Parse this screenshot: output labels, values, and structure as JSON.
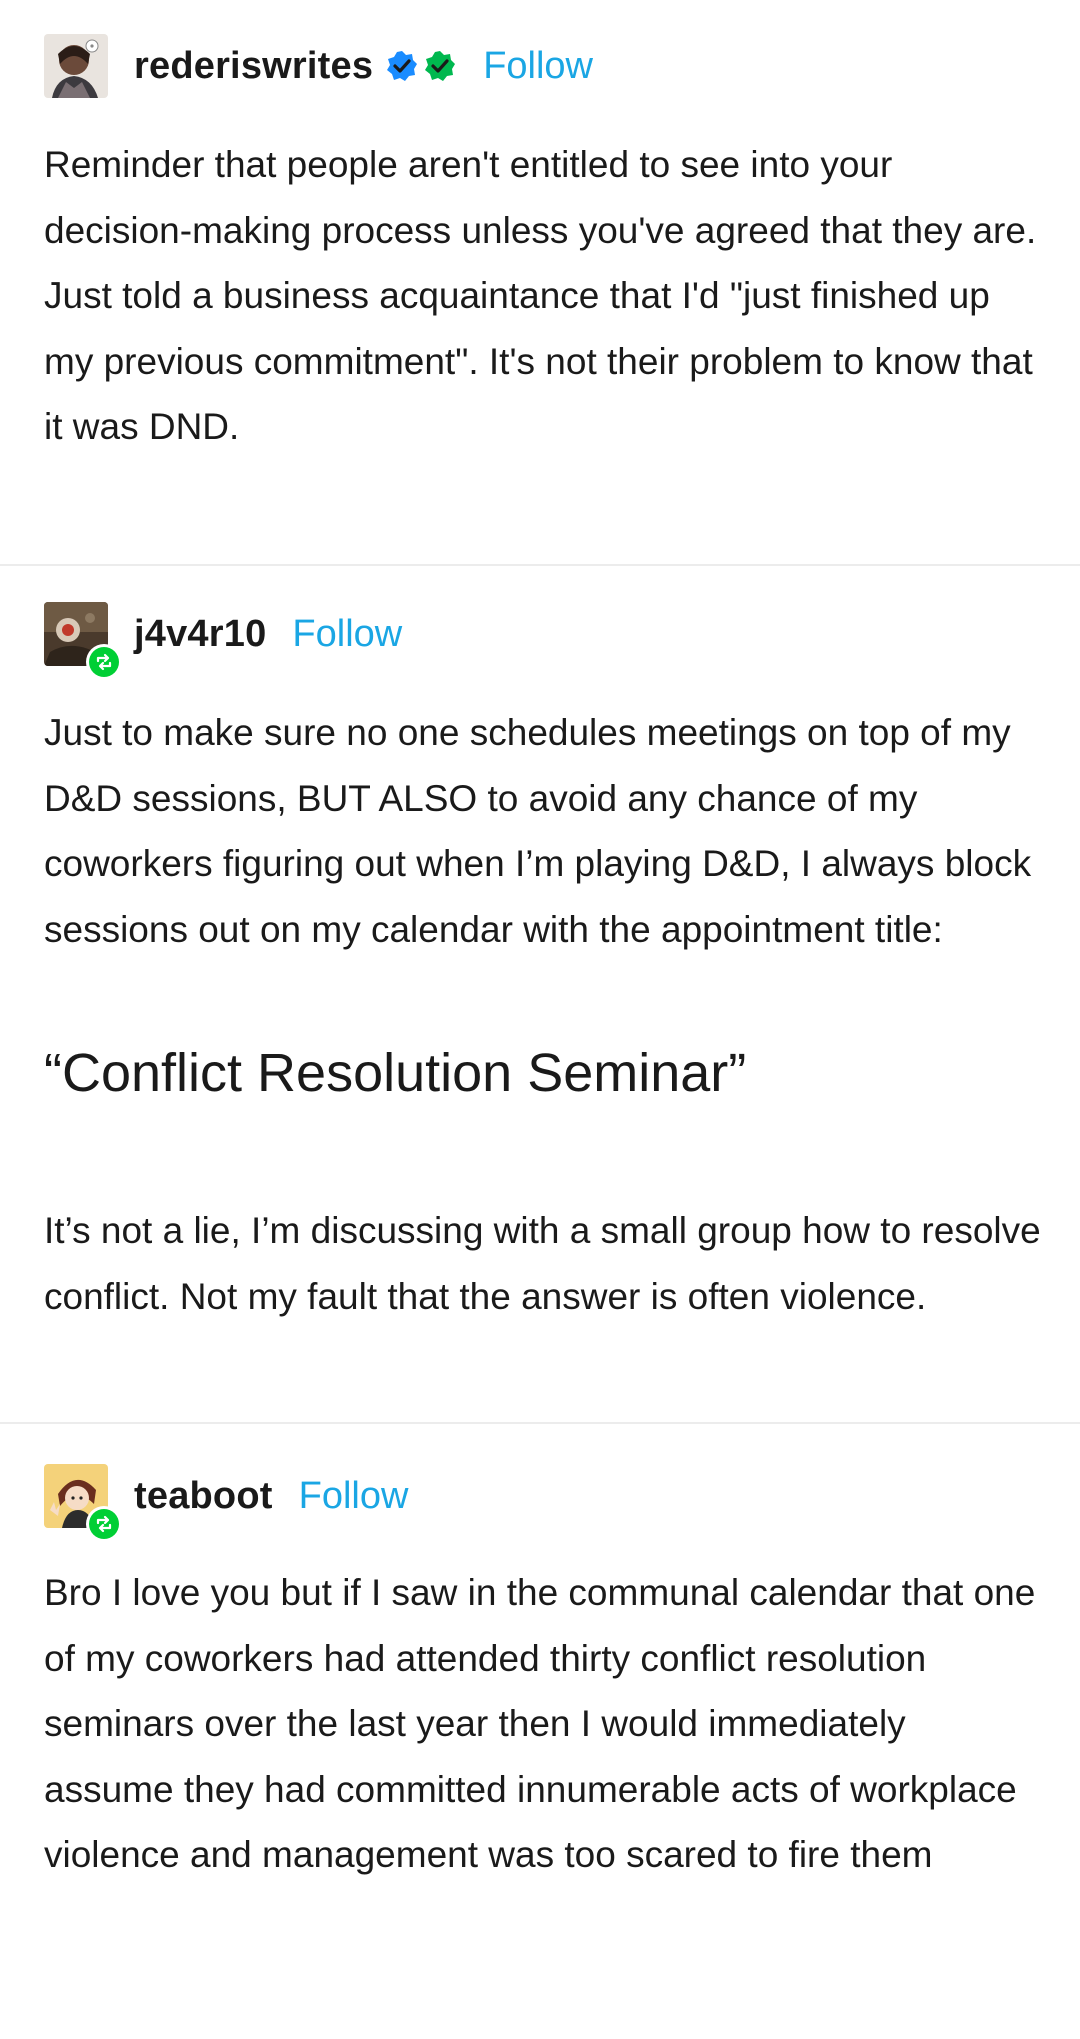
{
  "posts": [
    {
      "username": "rederiswrites",
      "follow_label": "Follow",
      "avatar_icon": "illustrated-portrait-avatar",
      "badges": [
        "blue-checkmark-icon",
        "green-checkmark-icon"
      ],
      "reblog": false,
      "paragraphs": [
        "Reminder that people aren't entitled to see into your decision-making process unless you've agreed that they are. Just told a business acquaintance that I'd \"just finished up my previous commitment\". It's not their problem to know that it was DND."
      ]
    },
    {
      "username": "j4v4r10",
      "follow_label": "Follow",
      "avatar_icon": "dark-textured-avatar",
      "reblog": true,
      "paragraphs": [
        "Just to make sure no one schedules meetings on top of my D&D sessions, BUT ALSO to avoid any chance of my coworkers figuring out when I’m playing D&D, I always block sessions out on my calendar with the appointment title:"
      ],
      "heading": "“Conflict Resolution Seminar”",
      "paragraphs_after": [
        "It’s not a lie, I’m discussing with a small group how to resolve conflict. Not my fault that the answer is often violence."
      ]
    },
    {
      "username": "teaboot",
      "follow_label": "Follow",
      "avatar_icon": "anime-character-avatar",
      "reblog": true,
      "paragraphs": [
        "Bro I love you but if I saw in the communal calendar that one of my coworkers had attended thirty conflict resolution seminars over the last year then I would immediately assume they had committed innumerable acts of workplace violence and management was too scared to fire them"
      ]
    }
  ],
  "colors": {
    "follow": "#1aa6e4",
    "reblog": "#00cf35",
    "text": "#1a1a1a",
    "divider": "#ececec",
    "verified_blue": "#1a8cff",
    "verified_green": "#00b84f"
  }
}
